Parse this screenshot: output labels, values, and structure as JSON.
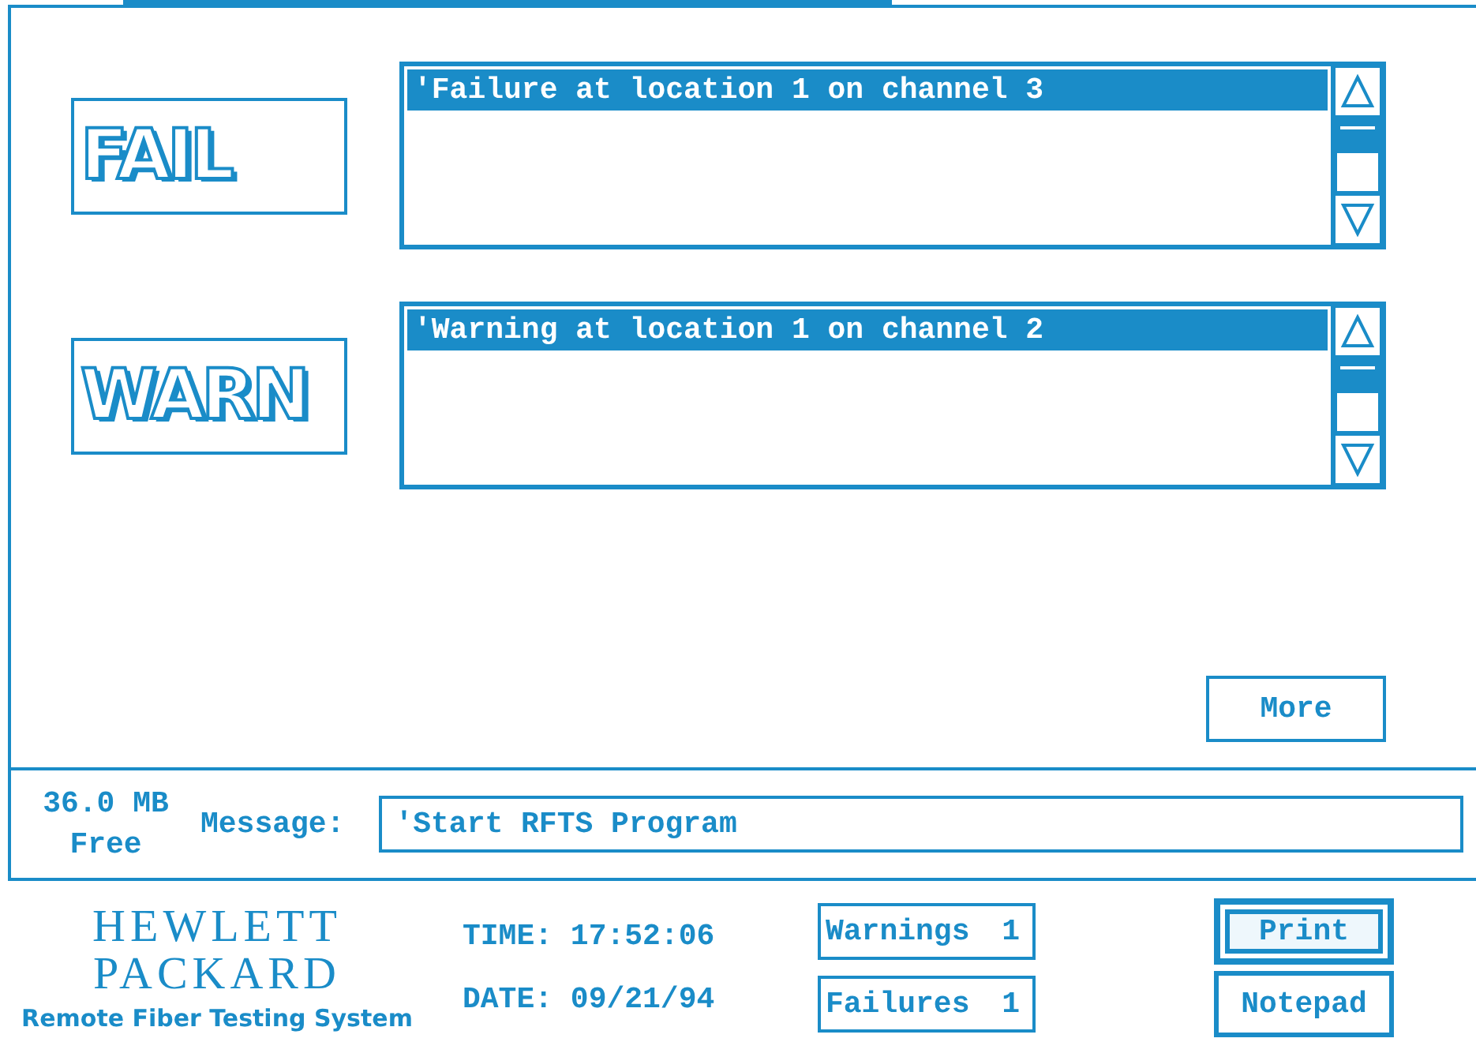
{
  "alerts": [
    {
      "label": "FAIL",
      "items": [
        {
          "text": "'Failure at location 1 on channel 3",
          "selected": true
        }
      ]
    },
    {
      "label": "WARN",
      "items": [
        {
          "text": "'Warning at location 1 on channel 2",
          "selected": true
        }
      ]
    }
  ],
  "more_button": "More",
  "status": {
    "memory": "36.0 MB",
    "memory_sub": "Free",
    "message_label": "Message:",
    "message": "'Start RFTS Program"
  },
  "footer": {
    "logo_line1": "HEWLETT",
    "logo_line2": "PACKARD",
    "product": "Remote Fiber Testing System",
    "time_label": "TIME:",
    "time": "17:52:06",
    "date_label": "DATE:",
    "date": "09/21/94",
    "counters": [
      {
        "label": "Warnings",
        "value": "1"
      },
      {
        "label": "Failures",
        "value": "1"
      }
    ],
    "buttons": [
      {
        "label": "Print",
        "selected": true
      },
      {
        "label": "Notepad",
        "selected": false
      }
    ]
  }
}
